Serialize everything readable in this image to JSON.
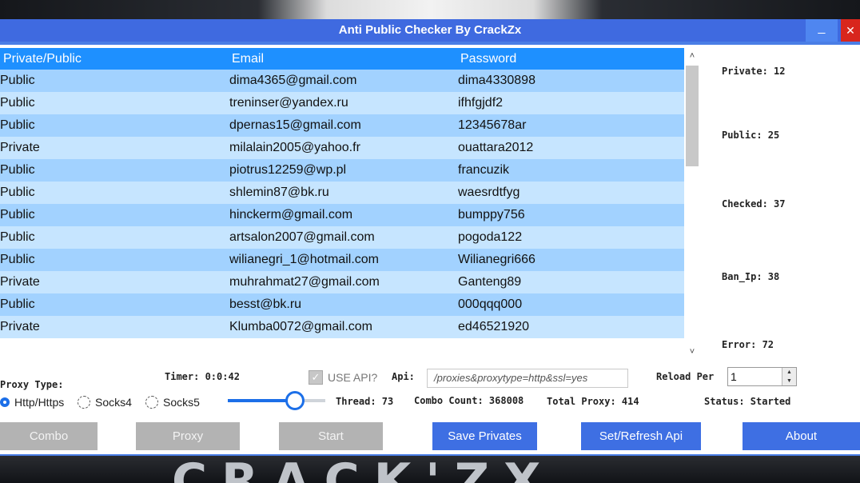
{
  "window": {
    "title": "Anti Public Checker By CrackZx",
    "minimize_glyph": "_",
    "close_glyph": "✕"
  },
  "grid": {
    "headers": [
      "Private/Public",
      "Email",
      "Password"
    ],
    "rows": [
      [
        "Public",
        "dima4365@gmail.com",
        "dima4330898"
      ],
      [
        "Public",
        "treninser@yandex.ru",
        "ifhfgjdf2"
      ],
      [
        "Public",
        "dpernas15@gmail.com",
        "12345678ar"
      ],
      [
        "Private",
        "milalain2005@yahoo.fr",
        "ouattara2012"
      ],
      [
        "Public",
        "piotrus12259@wp.pl",
        "francuzik"
      ],
      [
        "Public",
        "shlemin87@bk.ru",
        "waesrdtfyg"
      ],
      [
        "Public",
        "hinckerm@gmail.com",
        "bumppy756"
      ],
      [
        "Public",
        "artsalon2007@gmail.com",
        "pogoda122"
      ],
      [
        "Public",
        "wilianegri_1@hotmail.com",
        "Wilianegri666"
      ],
      [
        "Private",
        "muhrahmat27@gmail.com",
        "Ganteng89"
      ],
      [
        "Public",
        "besst@bk.ru",
        "000qqq000"
      ],
      [
        "Private",
        "Klumba0072@gmail.com",
        "ed46521920"
      ]
    ],
    "scroll_up": "˄",
    "scroll_down": "˅"
  },
  "stats": {
    "private": "Private: 12",
    "public": "Public: 25",
    "checked": "Checked: 37",
    "ban_ip": "Ban_Ip: 38",
    "error": "Error: 72"
  },
  "controls": {
    "proxy_type_label": "Proxy Type:",
    "proxy_options": [
      "Http/Https",
      "Socks4",
      "Socks5"
    ],
    "proxy_selected": "Http/Https",
    "timer": "Timer: 0:0:42",
    "use_api_label": "USE API?",
    "use_api_checked": true,
    "api_label": "Api:",
    "api_value": "/proxies&proxytype=http&ssl=yes",
    "reload_label": "Reload Per",
    "reload_value": "1",
    "thread": "Thread: 73",
    "thread_fraction": 0.69,
    "combo_count": "Combo Count: 368008",
    "total_proxy": "Total Proxy: 414",
    "status": "Status: Started"
  },
  "buttons": {
    "combo": "Combo",
    "proxy": "Proxy",
    "start": "Start",
    "save_privates": "Save Privates",
    "refresh_api": "Set/Refresh Api",
    "about": "About"
  },
  "background": {
    "logo_text": "CRACK'ZX"
  },
  "colors": {
    "titlebar": "#3f6ae0",
    "header": "#1e90ff",
    "row_odd": "#a2d2ff",
    "row_even": "#c6e5ff",
    "accent": "#1c6fe8",
    "close": "#d8261d"
  }
}
